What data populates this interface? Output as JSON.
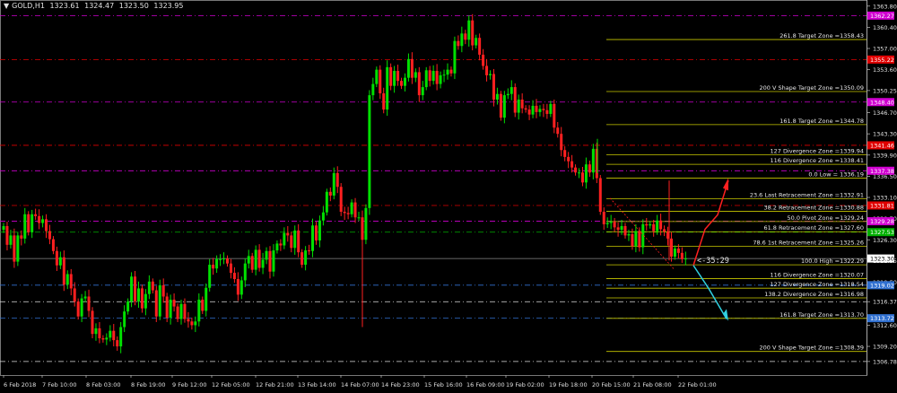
{
  "header": {
    "arrow": "▼",
    "symbol": "GOLD,H1",
    "open": "1323.61",
    "high": "1324.47",
    "low": "1323.50",
    "close": "1323.95"
  },
  "timer_text": "<-35:29",
  "colors": {
    "background": "#000000",
    "bull": "#00e000",
    "bear": "#ff2020",
    "zone_line": "#c8c800",
    "magenta": "#d000d0",
    "red_badge": "#e00000",
    "green_badge": "#00b000",
    "blue_badge": "#3070d0",
    "up_arrow": "#ff2020",
    "down_arrow": "#30d0e0"
  },
  "chart_data": {
    "type": "candlestick",
    "y_range": [
      1304.6,
      1364.2
    ],
    "y_ticks": [
      "1363.80",
      "1360.40",
      "1357.00",
      "1353.60",
      "1350.25",
      "1346.70",
      "1343.30",
      "1339.90",
      "1336.50",
      "1333.10",
      "1329.70",
      "1326.30",
      "1322.95",
      "1319.50",
      "1316.37",
      "1312.60",
      "1309.20",
      "1306.78"
    ],
    "x_ticks": [
      "6 Feb 2018",
      "7 Feb 10:00",
      "8 Feb 03:00",
      "8 Feb 19:00",
      "9 Feb 12:00",
      "12 Feb 05:00",
      "12 Feb 21:00",
      "13 Feb 14:00",
      "14 Feb 07:00",
      "14 Feb 23:00",
      "15 Feb 16:00",
      "16 Feb 09:00",
      "19 Feb 02:00",
      "19 Feb 18:00",
      "20 Feb 15:00",
      "21 Feb 08:00",
      "22 Feb 01:00"
    ],
    "current_price": "1323.30",
    "price_labels": [
      {
        "text": "1362.27",
        "value": 1362.27,
        "color": "magenta"
      },
      {
        "text": "1355.22",
        "value": 1355.22,
        "color": "red"
      },
      {
        "text": "1348.40",
        "value": 1348.4,
        "color": "magenta"
      },
      {
        "text": "1341.46",
        "value": 1341.46,
        "color": "red"
      },
      {
        "text": "1337.38",
        "value": 1337.38,
        "color": "magenta"
      },
      {
        "text": "1331.81",
        "value": 1331.81,
        "color": "red"
      },
      {
        "text": "1329.28",
        "value": 1329.28,
        "color": "magenta"
      },
      {
        "text": "1327.53",
        "value": 1327.53,
        "color": "green"
      },
      {
        "text": "1319.02",
        "value": 1319.02,
        "color": "blue"
      },
      {
        "text": "1313.72",
        "value": 1313.72,
        "color": "blue"
      }
    ],
    "zones": [
      {
        "label": "261.8 Target Zone =1358.43",
        "value": 1358.43
      },
      {
        "label": "200  V Shape Target Zone =1350.09",
        "value": 1350.09
      },
      {
        "label": "161.8 Target Zone =1344.78",
        "value": 1344.78
      },
      {
        "label": "127 Divergence Zone =1339.94",
        "value": 1339.94
      },
      {
        "label": "116 Divergence Zone =1338.41",
        "value": 1338.41
      },
      {
        "label": "0.0 Low = 1336.19",
        "value": 1336.19
      },
      {
        "label": "23.6 Last Retracement Zone =1332.91",
        "value": 1332.91
      },
      {
        "label": "38.2 Retracement Zone =1330.88",
        "value": 1330.88
      },
      {
        "label": "50.0 Pivot Zone =1329.24",
        "value": 1329.24
      },
      {
        "label": "61.8 Retracement Zone =1327.60",
        "value": 1327.6
      },
      {
        "label": "78.6 1st Retracement Zone =1325.26",
        "value": 1325.26
      },
      {
        "label": "100.0 High =1322.29",
        "value": 1322.29
      },
      {
        "label": "116 Divergence Zone =1320.07",
        "value": 1320.07
      },
      {
        "label": "127 Divergence Zone =1318.54",
        "value": 1318.54
      },
      {
        "label": "138.2 Divergence Zone =1316.98",
        "value": 1316.98
      },
      {
        "label": "161.8 Target Zone =1313.70",
        "value": 1313.7
      },
      {
        "label": "200 V Shape Target Zone =1308.39",
        "value": 1308.39
      }
    ],
    "close_path": [
      [
        0,
        1328.5
      ],
      [
        4,
        1325.5
      ],
      [
        8,
        1327
      ],
      [
        12,
        1322.8
      ],
      [
        16,
        1327
      ],
      [
        20,
        1326.5
      ],
      [
        24,
        1330.4
      ],
      [
        28,
        1327.5
      ],
      [
        32,
        1330.4
      ],
      [
        36,
        1330.1
      ],
      [
        40,
        1329
      ],
      [
        44,
        1329.6
      ],
      [
        48,
        1327.7
      ],
      [
        52,
        1326.4
      ],
      [
        56,
        1324.5
      ],
      [
        60,
        1322.2
      ],
      [
        64,
        1323.5
      ],
      [
        68,
        1319.1
      ],
      [
        72,
        1320.8
      ],
      [
        76,
        1318.5
      ],
      [
        80,
        1316.4
      ],
      [
        84,
        1314
      ],
      [
        88,
        1316.9
      ],
      [
        92,
        1317.2
      ],
      [
        96,
        1314.9
      ],
      [
        100,
        1311.2
      ],
      [
        104,
        1312.1
      ],
      [
        108,
        1310.5
      ],
      [
        112,
        1310.3
      ],
      [
        116,
        1310.6
      ],
      [
        120,
        1311.7
      ],
      [
        124,
        1310.2
      ],
      [
        128,
        1309.2
      ],
      [
        132,
        1312.3
      ],
      [
        136,
        1314.8
      ],
      [
        140,
        1316.4
      ],
      [
        144,
        1320.4
      ],
      [
        148,
        1316.4
      ],
      [
        152,
        1318.5
      ],
      [
        156,
        1315.3
      ],
      [
        160,
        1317.6
      ],
      [
        164,
        1319.6
      ],
      [
        168,
        1318.2
      ],
      [
        172,
        1314
      ],
      [
        176,
        1319
      ],
      [
        180,
        1317.2
      ],
      [
        184,
        1313.8
      ],
      [
        188,
        1316.7
      ],
      [
        192,
        1315.6
      ],
      [
        196,
        1313.6
      ],
      [
        200,
        1316
      ],
      [
        204,
        1313.6
      ],
      [
        208,
        1313.2
      ],
      [
        212,
        1312.6
      ],
      [
        216,
        1313.2
      ],
      [
        220,
        1316.7
      ],
      [
        224,
        1314.9
      ],
      [
        228,
        1318.6
      ],
      [
        232,
        1322.3
      ],
      [
        236,
        1321.7
      ],
      [
        240,
        1323.2
      ],
      [
        244,
        1323.2
      ],
      [
        248,
        1323.3
      ],
      [
        252,
        1322.5
      ],
      [
        256,
        1321
      ],
      [
        260,
        1320
      ],
      [
        264,
        1317.5
      ],
      [
        268,
        1319.8
      ],
      [
        272,
        1322.5
      ],
      [
        276,
        1323.7
      ],
      [
        280,
        1321.5
      ],
      [
        284,
        1324.7
      ],
      [
        288,
        1321.8
      ],
      [
        292,
        1323.1
      ],
      [
        296,
        1324.5
      ],
      [
        300,
        1321.2
      ],
      [
        304,
        1324.6
      ],
      [
        308,
        1325.7
      ],
      [
        312,
        1325.4
      ],
      [
        316,
        1327.4
      ],
      [
        320,
        1327
      ],
      [
        324,
        1325
      ],
      [
        328,
        1327.8
      ],
      [
        332,
        1324.3
      ],
      [
        336,
        1322.3
      ],
      [
        340,
        1324.6
      ],
      [
        344,
        1324.5
      ],
      [
        348,
        1328.6
      ],
      [
        352,
        1326.2
      ],
      [
        356,
        1329.4
      ],
      [
        360,
        1330.7
      ],
      [
        364,
        1334
      ],
      [
        368,
        1333.4
      ],
      [
        372,
        1337
      ],
      [
        376,
        1334.8
      ],
      [
        380,
        1330.8
      ],
      [
        384,
        1330.6
      ],
      [
        388,
        1330.4
      ],
      [
        392,
        1332.3
      ],
      [
        396,
        1329.9
      ],
      [
        400,
        1329.9
      ],
      [
        404,
        1326.3
      ],
      [
        408,
        1331.4
      ],
      [
        412,
        1349.5
      ],
      [
        416,
        1351.3
      ],
      [
        420,
        1353.6
      ],
      [
        424,
        1349.8
      ],
      [
        428,
        1347.2
      ],
      [
        432,
        1354
      ],
      [
        436,
        1351
      ],
      [
        440,
        1353.4
      ],
      [
        444,
        1351.8
      ],
      [
        448,
        1351
      ],
      [
        452,
        1352.3
      ],
      [
        456,
        1355.3
      ],
      [
        460,
        1352.3
      ],
      [
        464,
        1353.2
      ],
      [
        468,
        1349.5
      ],
      [
        472,
        1350.8
      ],
      [
        476,
        1353.5
      ],
      [
        480,
        1351.8
      ],
      [
        484,
        1353.4
      ],
      [
        488,
        1351.3
      ],
      [
        492,
        1352.7
      ],
      [
        496,
        1352.8
      ],
      [
        500,
        1353.6
      ],
      [
        504,
        1353
      ],
      [
        508,
        1358.2
      ],
      [
        512,
        1357.4
      ],
      [
        516,
        1359.4
      ],
      [
        520,
        1358.4
      ],
      [
        524,
        1361.5
      ],
      [
        528,
        1357.5
      ],
      [
        532,
        1358.7
      ],
      [
        536,
        1356
      ],
      [
        540,
        1354.2
      ],
      [
        544,
        1352.7
      ],
      [
        548,
        1352.9
      ],
      [
        552,
        1348.8
      ],
      [
        556,
        1349.7
      ],
      [
        560,
        1345.9
      ],
      [
        564,
        1349.5
      ],
      [
        568,
        1349.7
      ],
      [
        572,
        1350.8
      ],
      [
        576,
        1346.7
      ],
      [
        580,
        1348.8
      ],
      [
        584,
        1347.4
      ],
      [
        588,
        1347.2
      ],
      [
        592,
        1346.4
      ],
      [
        596,
        1347.8
      ],
      [
        600,
        1346.8
      ],
      [
        604,
        1347.3
      ],
      [
        608,
        1347.1
      ],
      [
        612,
        1346.5
      ],
      [
        616,
        1348.1
      ],
      [
        620,
        1344.3
      ],
      [
        624,
        1343.3
      ],
      [
        628,
        1340.7
      ],
      [
        632,
        1339.6
      ],
      [
        636,
        1338.9
      ],
      [
        640,
        1337.9
      ],
      [
        644,
        1337.1
      ],
      [
        648,
        1337.1
      ],
      [
        652,
        1335.5
      ],
      [
        656,
        1338.4
      ],
      [
        660,
        1337.1
      ],
      [
        664,
        1340.9
      ],
      [
        668,
        1336.2
      ],
      [
        672,
        1330.8
      ],
      [
        676,
        1328.8
      ],
      [
        680,
        1329
      ],
      [
        684,
        1329.2
      ],
      [
        688,
        1328.3
      ],
      [
        692,
        1327.9
      ],
      [
        696,
        1328.5
      ],
      [
        700,
        1327
      ],
      [
        704,
        1327.2
      ],
      [
        708,
        1325.3
      ],
      [
        712,
        1327.7
      ],
      [
        716,
        1325.1
      ],
      [
        720,
        1328.8
      ],
      [
        724,
        1328.6
      ],
      [
        728,
        1328.8
      ],
      [
        732,
        1327.7
      ],
      [
        736,
        1329.4
      ],
      [
        740,
        1328
      ],
      [
        744,
        1327.6
      ],
      [
        748,
        1326.5
      ],
      [
        752,
        1323.6
      ],
      [
        756,
        1324.9
      ],
      [
        760,
        1324.2
      ],
      [
        764,
        1323.2
      ],
      [
        768,
        1323.3
      ]
    ]
  }
}
